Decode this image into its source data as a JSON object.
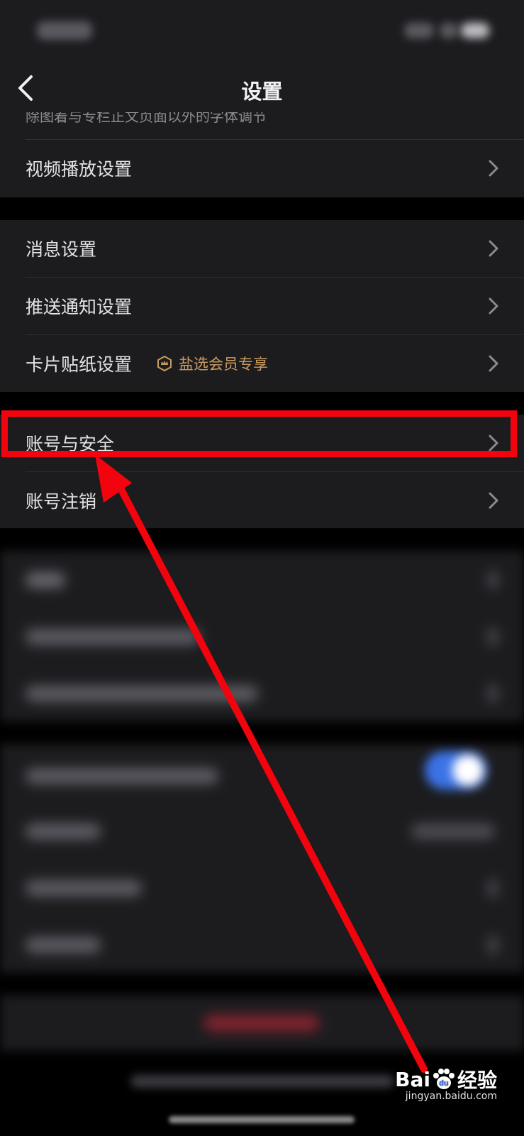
{
  "header": {
    "title": "设置"
  },
  "partial_top_text": "除图着与专栏正文页面以外的字体调节",
  "groups": {
    "playback": {
      "video_label": "视频播放设置"
    },
    "notifications": {
      "message_label": "消息设置",
      "push_label": "推送通知设置",
      "card_label": "卡片贴纸设置",
      "vip_badge": "盐选会员专享"
    },
    "account": {
      "security_label": "账号与安全",
      "cancel_label": "账号注销"
    }
  },
  "watermark": {
    "brand": "Bai",
    "paw": "du",
    "suffix": "经验",
    "url": "jingyan.baidu.com"
  },
  "colors": {
    "highlight": "#f3030d",
    "vip": "#c89b5f",
    "toggle": "#3b73e6",
    "background": "#1c1c1f"
  }
}
